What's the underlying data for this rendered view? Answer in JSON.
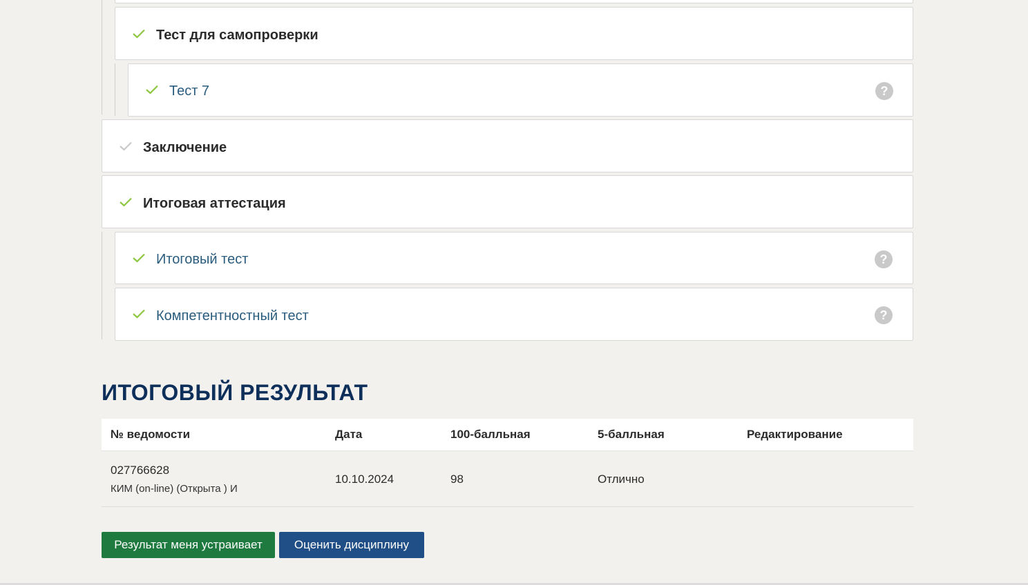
{
  "course_items": [
    {
      "label": "Тест для самопроверки",
      "kind": "section",
      "completed": true
    },
    {
      "label": "Тест 7",
      "kind": "test",
      "completed": true,
      "help_icon": "?"
    },
    {
      "label": "Заключение",
      "kind": "section",
      "completed": false
    },
    {
      "label": "Итоговая аттестация",
      "kind": "section",
      "completed": true
    },
    {
      "label": "Итоговый тест",
      "kind": "test",
      "completed": true,
      "help_icon": "?"
    },
    {
      "label": "Компетентностный тест",
      "kind": "test",
      "completed": true,
      "help_icon": "?"
    }
  ],
  "result": {
    "title": "ИТОГОВЫЙ РЕЗУЛЬТАТ",
    "columns": [
      "№ ведомости",
      "Дата",
      "100-балльная",
      "5-балльная",
      "Редактирование"
    ],
    "rows": [
      {
        "number": "027766628",
        "number_sub": "КИМ (on-line) (Открыта ) И",
        "date": "10.10.2024",
        "score100": "98",
        "score5": "Отлично",
        "edit": ""
      }
    ]
  },
  "buttons": {
    "accept": "Результат меня устраивает",
    "rate": "Оценить дисциплину"
  },
  "colors": {
    "check_done": "#8dc63f",
    "check_pending": "#c8c8c8",
    "title": "#0e2f5a",
    "accept_button": "#1e7a3e",
    "rate_button": "#1f4f86",
    "link_text": "#2a5c7e"
  }
}
